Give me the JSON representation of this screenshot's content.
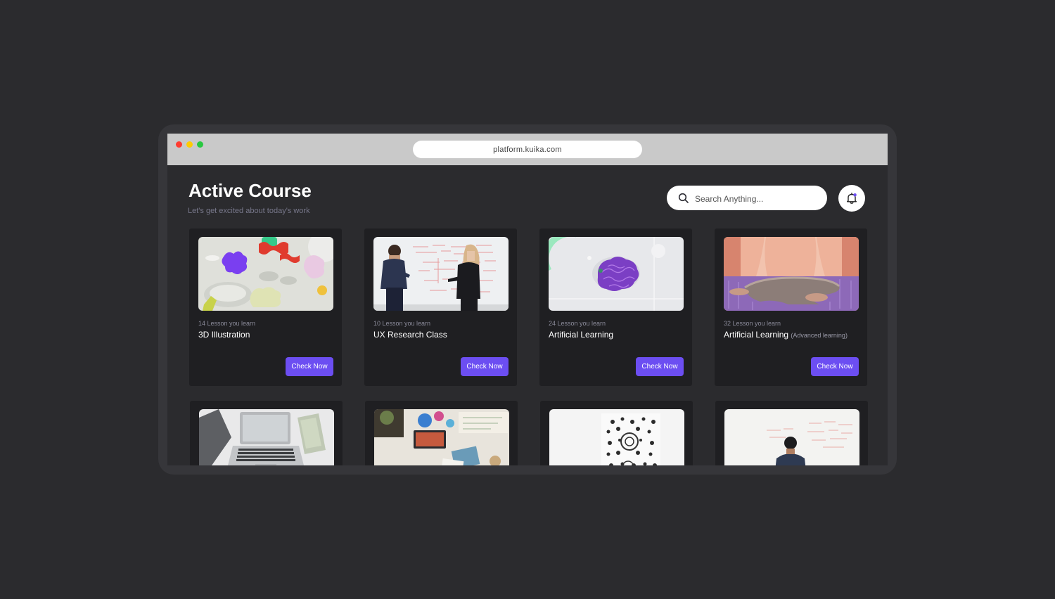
{
  "browser": {
    "url": "platform.kuika.com"
  },
  "header": {
    "title": "Active Course",
    "subtitle": "Let's get excited about today's work"
  },
  "search": {
    "placeholder": "Search Anything..."
  },
  "colors": {
    "accent": "#6c4ef2",
    "card_bg": "#1f1f22",
    "page_bg": "#2b2b2e"
  },
  "courses": [
    {
      "lessons": "14 Lesson you learn",
      "title": "3D Illustration",
      "note": "",
      "button": "Check Now",
      "image": "3d-shapes-image"
    },
    {
      "lessons": "10 Lesson you learn",
      "title": "UX Research Class",
      "note": "",
      "button": "Check Now",
      "image": "whiteboard-meeting-image"
    },
    {
      "lessons": "24 Lesson you learn",
      "title": "Artificial Learning",
      "note": "",
      "button": "Check Now",
      "image": "ai-brain-image"
    },
    {
      "lessons": "32 Lesson you learn",
      "title": "Artificial Learning",
      "note": "(Advanced learning)",
      "button": "Check Now",
      "image": "purple-room-image"
    }
  ],
  "more_courses": [
    {
      "image": "laptop-desk-image"
    },
    {
      "image": "design-desk-image"
    },
    {
      "image": "pattern-art-image"
    },
    {
      "image": "whiteboard-man-image"
    }
  ]
}
